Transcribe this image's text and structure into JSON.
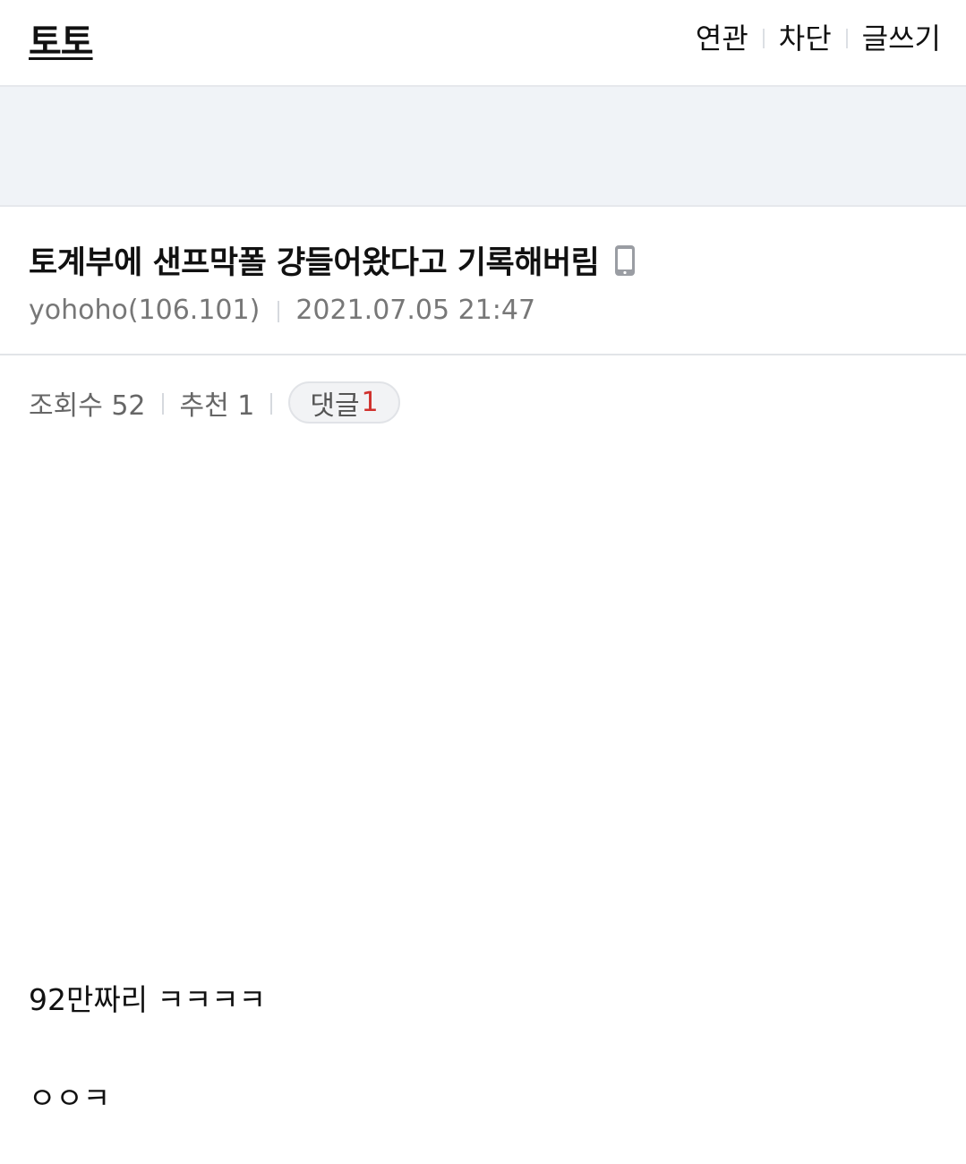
{
  "header": {
    "logo": "토토",
    "nav": [
      {
        "label": "연관"
      },
      {
        "label": "차단"
      },
      {
        "label": "글쓰기"
      }
    ]
  },
  "post": {
    "title": "토계부에 샌프막폴 걍들어왔다고 기록해버림",
    "title_icon": "mobile-phone-icon",
    "author": "yohoho(106.101)",
    "datetime": "2021.07.05 21:47",
    "views_label": "조회수 52",
    "recommend_label": "추천 1",
    "comment_label": "댓글",
    "comment_count": "1",
    "body": [
      "92만짜리 ㅋㅋㅋㅋ",
      "ㅇㅇㅋ"
    ]
  },
  "colors": {
    "banner_bg": "#f0f3f7",
    "comment_count": "#d0312d",
    "meta_text": "#777777"
  }
}
